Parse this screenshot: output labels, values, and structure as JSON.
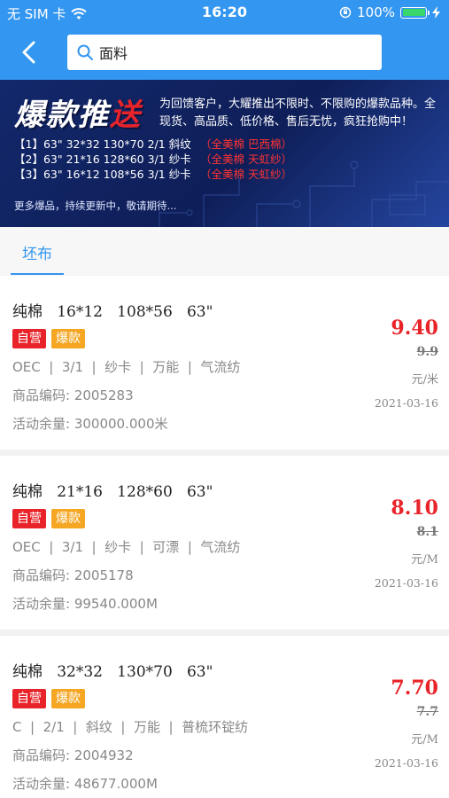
{
  "status_bar": {
    "carrier": "无 SIM 卡",
    "time": "16:20",
    "battery": "100%",
    "battery_level": 1.0
  },
  "nav": {
    "search_value": "面料"
  },
  "banner": {
    "title_a": "爆款",
    "title_b": "推",
    "title_c": "送",
    "desc": "为回馈客户，大耀推出不限时、不限购的爆款品种。全现货、高品质、低价格、售后无忧，疯狂抢购中！",
    "items": [
      {
        "spec": "【1】63\" 32*32 130*70  2/1 斜纹",
        "tag": "（全美棉 巴西棉）"
      },
      {
        "spec": "【2】63\" 21*16 128*60  3/1 纱卡",
        "tag": "（全美棉 天虹纱）"
      },
      {
        "spec": "【3】63\" 16*12 108*56  3/1 纱卡",
        "tag": "（全美棉 天虹纱）"
      }
    ],
    "more": "更多爆品，持续更新中，敬请期待..."
  },
  "tabs": [
    {
      "label": "坯布"
    }
  ],
  "products": [
    {
      "title": "纯棉   16*12   108*56   63\"",
      "badge_self": "自营",
      "badge_hot": "爆款",
      "attrs": "OEC  |  3/1  |  纱卡  |  万能  |  气流纺",
      "code": "商品编码: 2005283",
      "stock": "活动余量:  300000.000米",
      "price": "9.40",
      "original_price": "9.9",
      "unit": "元/米",
      "date": "2021-03-16"
    },
    {
      "title": "纯棉   21*16   128*60   63\"",
      "badge_self": "自营",
      "badge_hot": "爆款",
      "attrs": "OEC  |  3/1  |  纱卡  |  可漂  |  气流纺",
      "code": "商品编码: 2005178",
      "stock": "活动余量:  99540.000M",
      "price": "8.10",
      "original_price": "8.1",
      "unit": "元/M",
      "date": "2021-03-16"
    },
    {
      "title": "纯棉   32*32   130*70   63\"",
      "badge_self": "自营",
      "badge_hot": "爆款",
      "attrs": "C  |  2/1  |  斜纹  |  万能  |  普梳环锭纺",
      "code": "商品编码: 2004932",
      "stock": "活动余量:  48677.000M",
      "price": "7.70",
      "original_price": "7.7",
      "unit": "元/M",
      "date": "2021-03-16"
    }
  ],
  "colors": {
    "primary": "#3396f0",
    "price_red": "#e8242a",
    "badge_orange": "#f5a623"
  }
}
